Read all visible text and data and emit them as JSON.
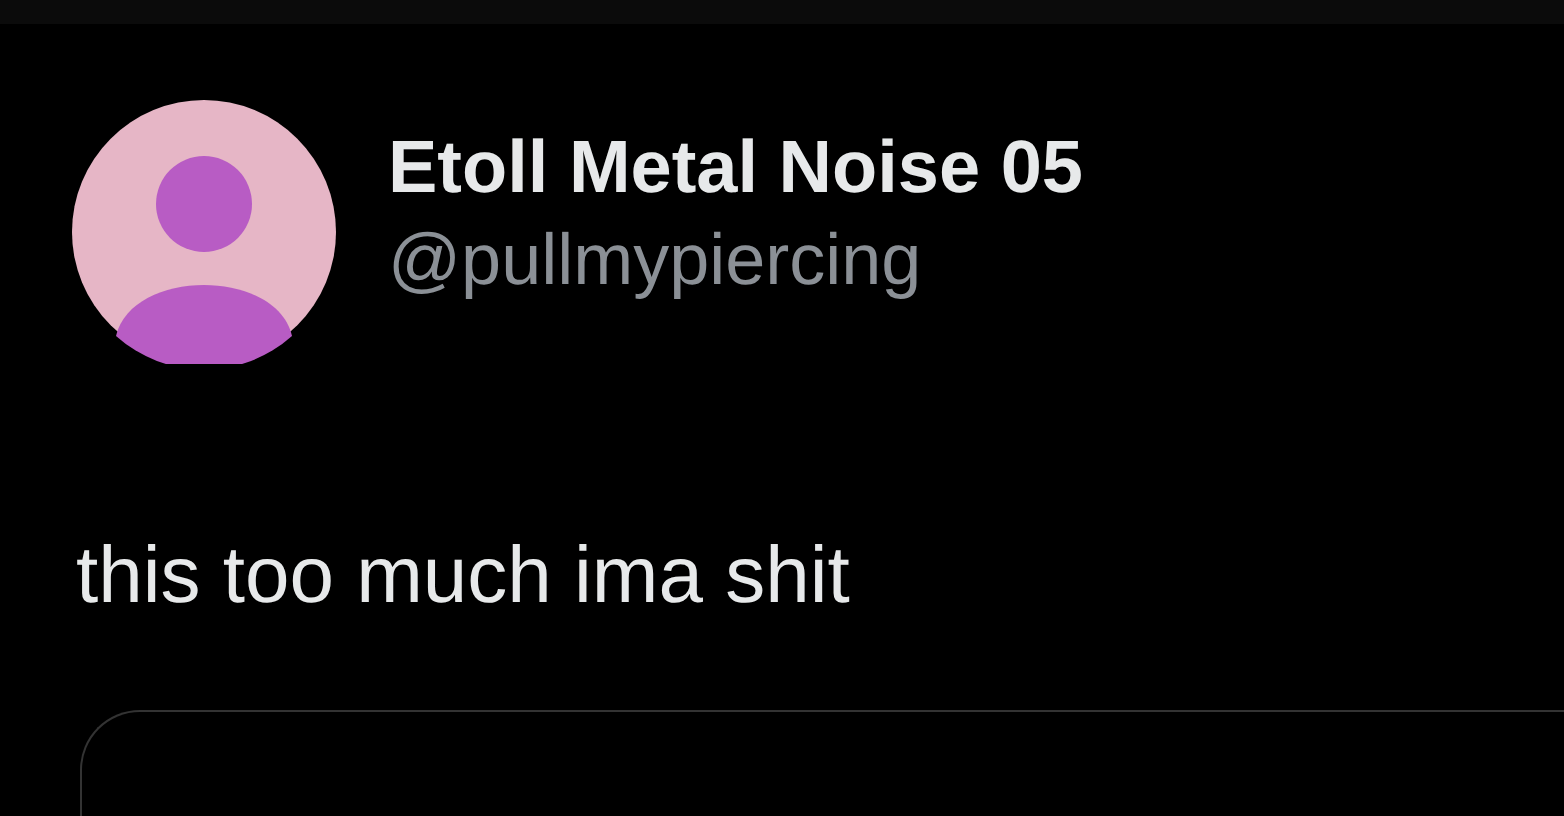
{
  "tweet": {
    "display_name": "Etoll Metal Noise 05",
    "handle": "@pullmypiercing",
    "text": "this too much ima shit"
  }
}
